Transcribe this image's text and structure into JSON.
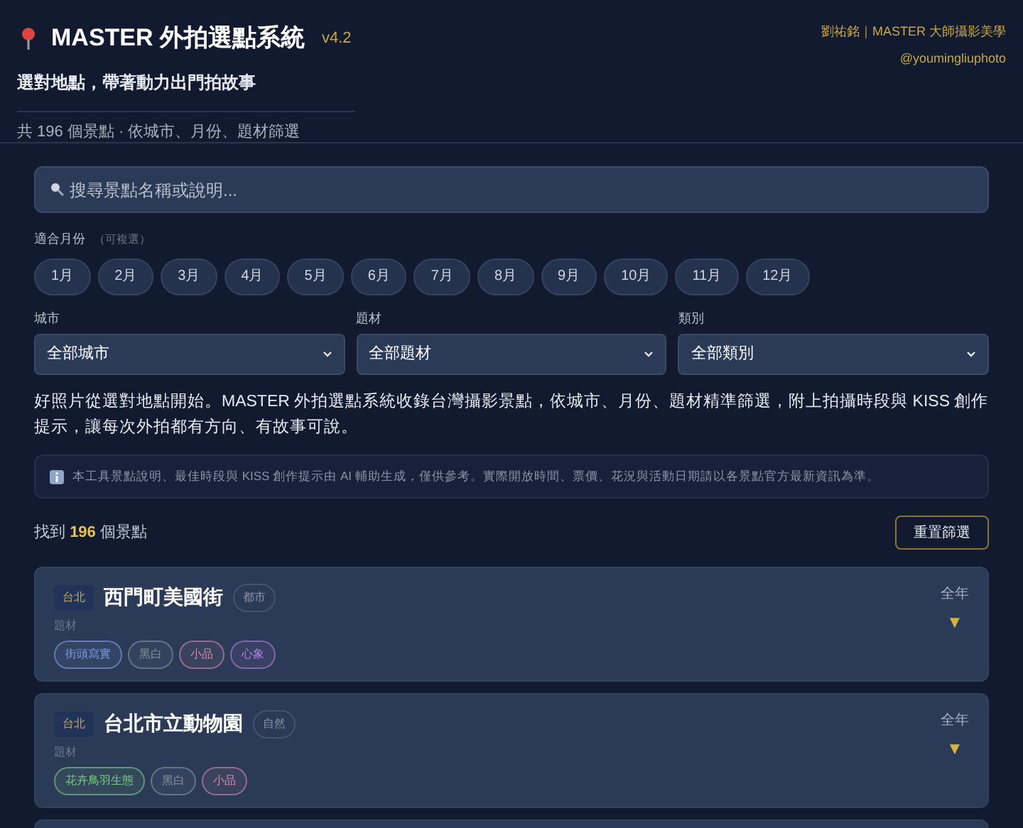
{
  "header": {
    "title": "MASTER 外拍選點系統",
    "version": "v4.2",
    "subtitle": "選對地點，帶著動力出門拍故事",
    "summary": "共 196 個景點 · 依城市、月份、題材篩選",
    "credit": "劉祐銘｜MASTER 大師攝影美學",
    "handle": "@youmingliuphoto"
  },
  "search": {
    "placeholder": "搜尋景點名稱或說明..."
  },
  "months": {
    "label": "適合月份",
    "hint": "（可複選）",
    "items": [
      {
        "label": "1月",
        "selected": false
      },
      {
        "label": "2月",
        "selected": false
      },
      {
        "label": "3月",
        "selected": false
      },
      {
        "label": "4月",
        "selected": false
      },
      {
        "label": "5月",
        "selected": false
      },
      {
        "label": "6月",
        "selected": false
      },
      {
        "label": "7月",
        "selected": false
      },
      {
        "label": "8月",
        "selected": false
      },
      {
        "label": "9月",
        "selected": false
      },
      {
        "label": "10月",
        "selected": false
      },
      {
        "label": "11月",
        "selected": false
      },
      {
        "label": "12月",
        "selected": false
      }
    ]
  },
  "filters": [
    {
      "label": "城市",
      "value": "全部城市"
    },
    {
      "label": "題材",
      "value": "全部題材"
    },
    {
      "label": "類別",
      "value": "全部類別"
    }
  ],
  "intro": "好照片從選對地點開始。MASTER 外拍選點系統收錄台灣攝影景點，依城市、月份、題材精準篩選，附上拍攝時段與 KISS 創作提示，讓每次外拍都有方向、有故事可說。",
  "notice": "本工具景點說明、最佳時段與 KISS 創作提示由 AI 輔助生成，僅供參考。實際開放時間、票價、花況與活動日期請以各景點官方最新資訊為準。",
  "results": {
    "prefix": "找到",
    "count": "196",
    "suffix": "個景點",
    "reset": "重置篩選"
  },
  "spots": [
    {
      "city": "台北",
      "name": "西門町美國街",
      "category": "都市",
      "topic_label": "題材",
      "season": "全年",
      "toggle": "▼",
      "tags": [
        {
          "label": "街頭寫實",
          "color": "#7fa0e8"
        },
        {
          "label": "黑白",
          "color": "#8a919c"
        },
        {
          "label": "小品",
          "color": "#d08aa8"
        },
        {
          "label": "心象",
          "color": "#b07fe0"
        }
      ]
    },
    {
      "city": "台北",
      "name": "台北市立動物園",
      "category": "自然",
      "topic_label": "題材",
      "season": "全年",
      "toggle": "▼",
      "tags": [
        {
          "label": "花卉鳥羽生態",
          "color": "#7cc98a"
        },
        {
          "label": "黑白",
          "color": "#8a919c"
        },
        {
          "label": "小品",
          "color": "#d08aa8"
        }
      ]
    }
  ]
}
